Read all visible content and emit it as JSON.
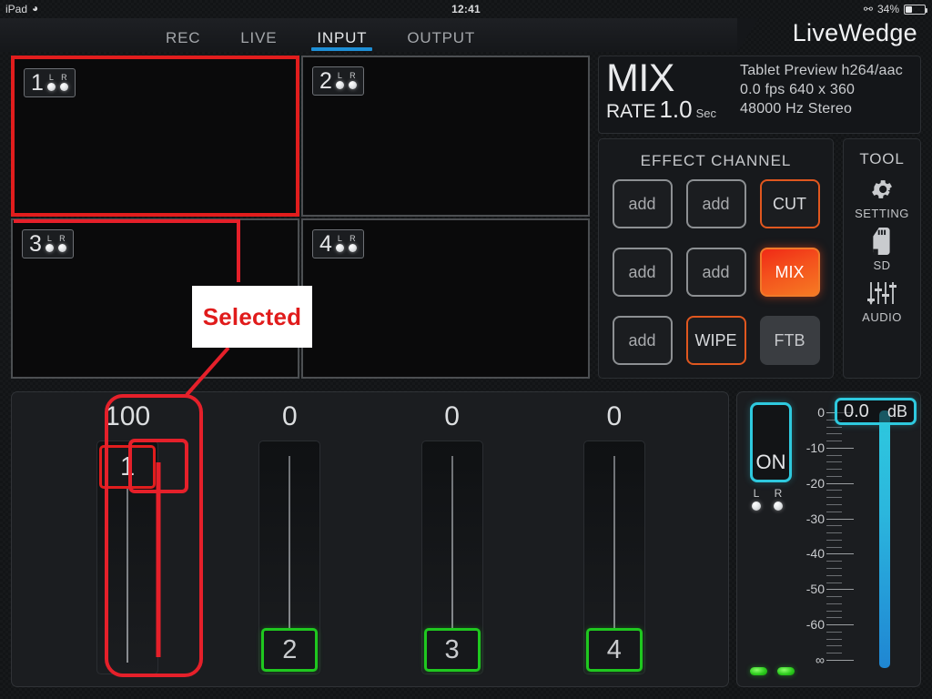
{
  "statusbar": {
    "device": "iPad",
    "wifi_icon": "wifi-icon",
    "time": "12:41",
    "bluetooth_icon": "bluetooth-icon",
    "battery_percent": "34%",
    "battery_level": 34
  },
  "topbar": {
    "brand": "LiveWedge",
    "tabs": [
      {
        "label": "REC",
        "active": false
      },
      {
        "label": "LIVE",
        "active": false
      },
      {
        "label": "INPUT",
        "active": true
      },
      {
        "label": "OUTPUT",
        "active": false
      }
    ],
    "active_tab_color": "#1e8fd6"
  },
  "quadrants": [
    {
      "number": "1",
      "left_label": "L",
      "right_label": "R",
      "selected": true
    },
    {
      "number": "2",
      "left_label": "L",
      "right_label": "R",
      "selected": false
    },
    {
      "number": "3",
      "left_label": "L",
      "right_label": "R",
      "selected": false
    },
    {
      "number": "4",
      "left_label": "L",
      "right_label": "R",
      "selected": false
    }
  ],
  "mix_info": {
    "mix_label": "MIX",
    "rate_label": "RATE",
    "rate_value": "1.0",
    "rate_unit": "Sec",
    "line1": "Tablet Preview h264/aac",
    "line2": "0.0  fps  640 x 360",
    "line3": "48000 Hz  Stereo"
  },
  "effect_channel": {
    "title": "EFFECT CHANNEL",
    "buttons": [
      {
        "label": "add",
        "style": "empty"
      },
      {
        "label": "add",
        "style": "empty"
      },
      {
        "label": "CUT",
        "style": "outline-red"
      },
      {
        "label": "add",
        "style": "empty"
      },
      {
        "label": "add",
        "style": "empty"
      },
      {
        "label": "MIX",
        "style": "filled-red"
      },
      {
        "label": "add",
        "style": "empty"
      },
      {
        "label": "WIPE",
        "style": "outline-red"
      },
      {
        "label": "FTB",
        "style": "grey"
      }
    ],
    "active_color": "#f4521d"
  },
  "tool": {
    "title": "TOOL",
    "items": [
      {
        "label": "SETTING",
        "icon": "gear-icon"
      },
      {
        "label": "SD",
        "icon": "sd-card-icon"
      },
      {
        "label": "AUDIO",
        "icon": "faders-icon"
      }
    ]
  },
  "faders": [
    {
      "value": "100",
      "handle": "1",
      "position_pct": 100,
      "highlighted": true
    },
    {
      "value": "0",
      "handle": "2",
      "position_pct": 0,
      "highlighted": false
    },
    {
      "value": "0",
      "handle": "3",
      "position_pct": 0,
      "highlighted": false
    },
    {
      "value": "0",
      "handle": "4",
      "position_pct": 0,
      "highlighted": false
    }
  ],
  "audio": {
    "on_label": "ON",
    "left_label": "L",
    "right_label": "R",
    "db_value": "0.0",
    "db_unit": "dB",
    "meter_pct": 100,
    "accent_color": "#2ec9de",
    "scale_labels": [
      "0",
      "-10",
      "-20",
      "-30",
      "-40",
      "-50",
      "-60",
      "∞"
    ]
  },
  "annotation": {
    "label": "Selected",
    "color": "#e01b1b"
  }
}
